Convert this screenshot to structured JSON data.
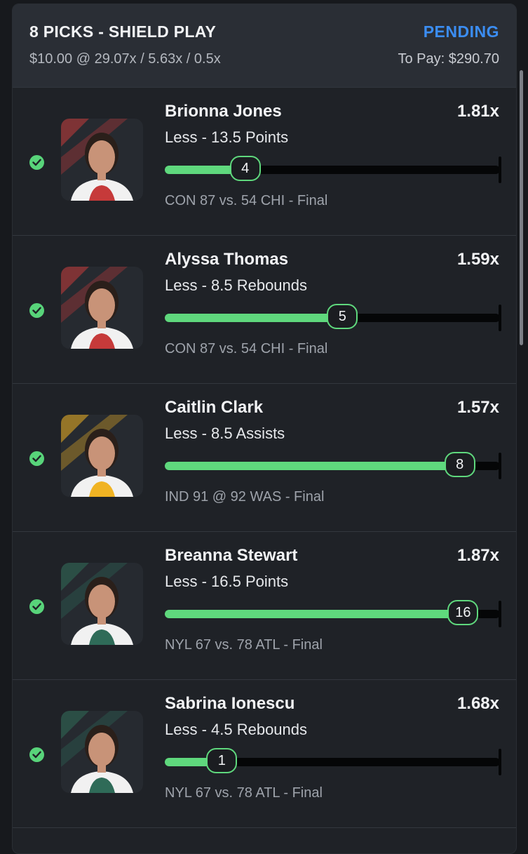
{
  "header": {
    "title": "8 PICKS - SHIELD PLAY",
    "status": "PENDING",
    "stake_info": "$10.00 @ 29.07x / 5.63x / 0.5x",
    "to_pay": "To Pay: $290.70"
  },
  "colors": {
    "accent_blue": "#3b8df2",
    "progress_green": "#5fd87d",
    "background": "#1f2227"
  },
  "picks": [
    {
      "name": "Brionna Jones",
      "multiplier": "1.81x",
      "line": "Less - 13.5 Points",
      "value": "4",
      "progress_fraction": 0.24,
      "game": "CON 87 vs. 54 CHI - Final",
      "status_icon": "check-circle-icon",
      "jersey_color": "#c63a3a"
    },
    {
      "name": "Alyssa Thomas",
      "multiplier": "1.59x",
      "line": "Less - 8.5 Rebounds",
      "value": "5",
      "progress_fraction": 0.53,
      "game": "CON 87 vs. 54 CHI - Final",
      "status_icon": "check-circle-icon",
      "jersey_color": "#c63a3a"
    },
    {
      "name": "Caitlin Clark",
      "multiplier": "1.57x",
      "line": "Less - 8.5 Assists",
      "value": "8",
      "progress_fraction": 0.88,
      "game": "IND 91 @ 92 WAS - Final",
      "status_icon": "check-circle-icon",
      "jersey_color": "#f0b323"
    },
    {
      "name": "Breanna Stewart",
      "multiplier": "1.87x",
      "line": "Less - 16.5 Points",
      "value": "16",
      "progress_fraction": 0.89,
      "game": "NYL 67 vs. 78 ATL - Final",
      "status_icon": "check-circle-icon",
      "jersey_color": "#2f6b58"
    },
    {
      "name": "Sabrina Ionescu",
      "multiplier": "1.68x",
      "line": "Less - 4.5 Rebounds",
      "value": "1",
      "progress_fraction": 0.17,
      "game": "NYL 67 vs. 78 ATL - Final",
      "status_icon": "check-circle-icon",
      "jersey_color": "#2f6b58"
    }
  ]
}
